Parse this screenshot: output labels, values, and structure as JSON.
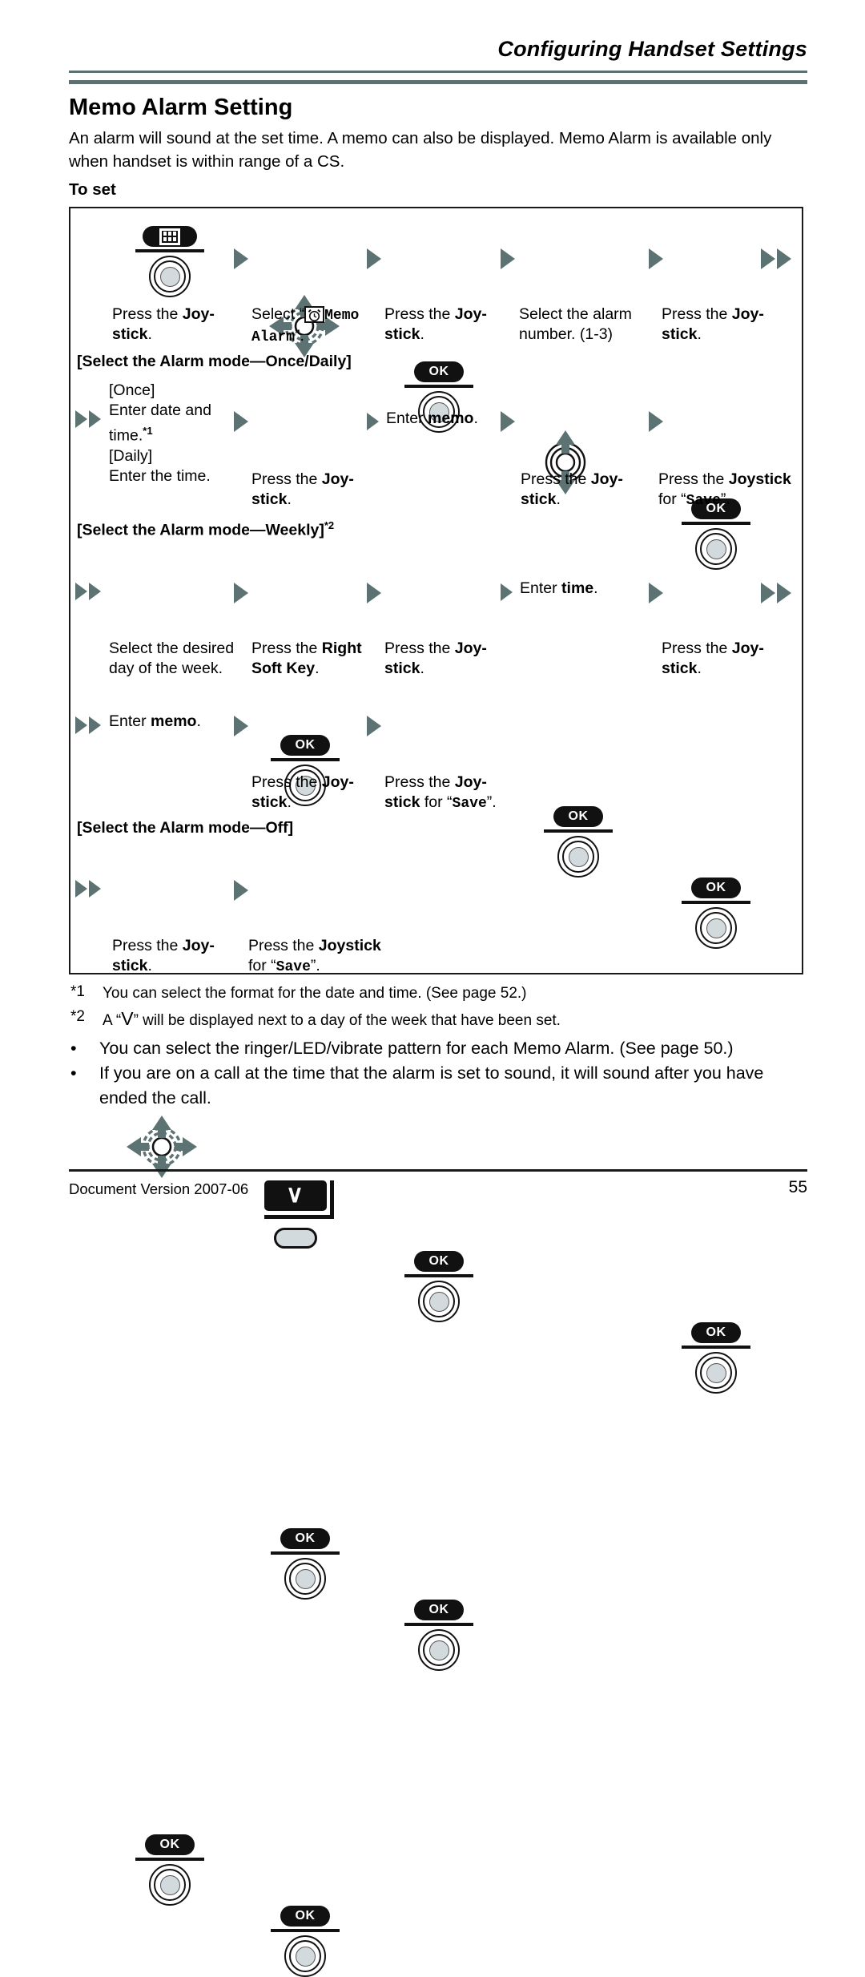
{
  "header": {
    "running_title": "Configuring Handset Settings"
  },
  "section": {
    "title": "Memo Alarm Setting",
    "intro": "An alarm will sound at the set time. A memo can also be displayed. Memo Alarm is available only when handset is within range of a CS.",
    "subtitle": "To set"
  },
  "flow": {
    "row1": {
      "step1_caption_a": "Press the ",
      "step1_caption_b": "Joy-",
      "step1_caption_c": "stick",
      "step1_caption_d": ".",
      "step1_icon": "menu-grid-key",
      "step2_caption_pre": "Select “",
      "step2_caption_icon": "memo-alarm-clock-icon",
      "step2_caption_mono1": "Memo",
      "step2_caption_mono2": "Alarm",
      "step2_caption_post": "”.",
      "step3_pill": "OK",
      "step3_caption_a": "Press the ",
      "step3_caption_b": "Joy-",
      "step3_caption_c": "stick",
      "step3_caption_d": ".",
      "step4_caption_l1": "Select the alarm",
      "step4_caption_l2": "number. (1-3)",
      "step5_pill": "OK",
      "step5_caption_a": "Press the ",
      "step5_caption_b": "Joy-",
      "step5_caption_c": "stick",
      "step5_caption_d": "."
    },
    "once_daily": {
      "label": "[Select the Alarm mode—Once/Daily]",
      "text_l1": "[Once]",
      "text_l2": "Enter date and",
      "text_l3": "time.",
      "text_l3_sup": "*1",
      "text_l4": "[Daily]",
      "text_l5": "Enter the time.",
      "s2_pill": "OK",
      "s2_cap_a": "Press the ",
      "s2_cap_b": "Joy-",
      "s2_cap_c": "stick",
      "s2_cap_d": ".",
      "s3_cap_a": "Enter ",
      "s3_cap_b": "memo",
      "s3_cap_c": ".",
      "s4_pill": "OK",
      "s4_cap_a": "Press the ",
      "s4_cap_b": "Joy-",
      "s4_cap_c": "stick",
      "s4_cap_d": ".",
      "s5_pill": "OK",
      "s5_cap_a": "Press the ",
      "s5_cap_b": "Joystick",
      "s5_cap_c": "for “",
      "s5_cap_mono": "Save",
      "s5_cap_d": "”."
    },
    "weekly": {
      "label": "[Select the Alarm mode—Weekly]",
      "label_sup": "*2",
      "s1_cap_l1": "Select the desired",
      "s1_cap_l2": "day of the week.",
      "s2_icon": "right-soft-key",
      "s2_cap_a": "Press the ",
      "s2_cap_b": "Right",
      "s2_cap_c": "Soft Key",
      "s2_cap_d": ".",
      "s3_pill": "OK",
      "s3_cap_a": "Press the ",
      "s3_cap_b": "Joy-",
      "s3_cap_c": "stick",
      "s3_cap_d": ".",
      "s4_cap_a": "Enter ",
      "s4_cap_b": "time",
      "s4_cap_c": ".",
      "s5_pill": "OK",
      "s5_cap_a": "Press the ",
      "s5_cap_b": "Joy-",
      "s5_cap_c": "stick",
      "s5_cap_d": ".",
      "r2_s1_cap_a": "Enter ",
      "r2_s1_cap_b": "memo",
      "r2_s1_cap_c": ".",
      "r2_s2_pill": "OK",
      "r2_s2_cap_a": "Press the ",
      "r2_s2_cap_b": "Joy-",
      "r2_s2_cap_c": "stick",
      "r2_s2_cap_d": ".",
      "r2_s3_pill": "OK",
      "r2_s3_cap_a": "Press the ",
      "r2_s3_cap_b": "Joy-",
      "r2_s3_cap_c": "stick",
      "r2_s3_cap_d": " for “",
      "r2_s3_cap_mono": "Save",
      "r2_s3_cap_e": "”."
    },
    "off": {
      "label": "[Select the Alarm mode—Off]",
      "s1_pill": "OK",
      "s1_cap_a": "Press the ",
      "s1_cap_b": "Joy-",
      "s1_cap_c": "stick",
      "s1_cap_d": ".",
      "s2_pill": "OK",
      "s2_cap_a": "Press the ",
      "s2_cap_b": "Joystick",
      "s2_cap_c": "for “",
      "s2_cap_mono": "Save",
      "s2_cap_d": "”."
    }
  },
  "footnotes": [
    {
      "mark": "*1",
      "text": "You can select the format for the date and time. (See page 52.)"
    },
    {
      "mark": "*2",
      "text_pre": "A “",
      "glyph": "V",
      "text_post": "” will be displayed next to a day of the week that have been set."
    }
  ],
  "bullets": [
    "You can select the ringer/LED/vibrate pattern for each Memo Alarm. (See page 50.)",
    "If you are on a call at the time that the alarm is set to sound, it will sound after you have ended the call."
  ],
  "bullet_marker": "•",
  "footer": {
    "left": "Document Version 2007-06",
    "page": "55"
  },
  "colors": {
    "accent_arrow": "#5d7272",
    "rule": "#5d6f6f",
    "key_fill": "#111111",
    "disc_core": "#d2dade"
  }
}
